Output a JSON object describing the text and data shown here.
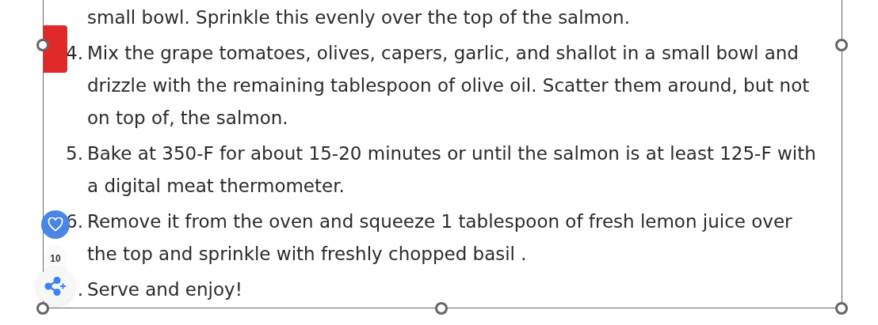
{
  "continuation": "small bowl. Sprinkle this evenly over the top of the salmon.",
  "steps": [
    {
      "marker": "4.",
      "lines": [
        "Mix the grape tomatoes, olives, capers, garlic, and shallot in a small bowl and",
        "drizzle with the remaining tablespoon of olive oil. Scatter them around, but not",
        "on top of, the salmon."
      ]
    },
    {
      "marker": "5.",
      "lines": [
        "Bake at 350-F for about 15-20 minutes or until the salmon is at least 125-F with",
        "a digital meat thermometer."
      ]
    },
    {
      "marker": "6.",
      "lines": [
        "Remove it from the oven and squeeze 1 tablespoon of fresh lemon juice over",
        "the top and sprinkle with freshly chopped basil ."
      ]
    },
    {
      "marker": ".",
      "lines": [
        "Serve and enjoy!"
      ]
    }
  ],
  "like_count": "10"
}
